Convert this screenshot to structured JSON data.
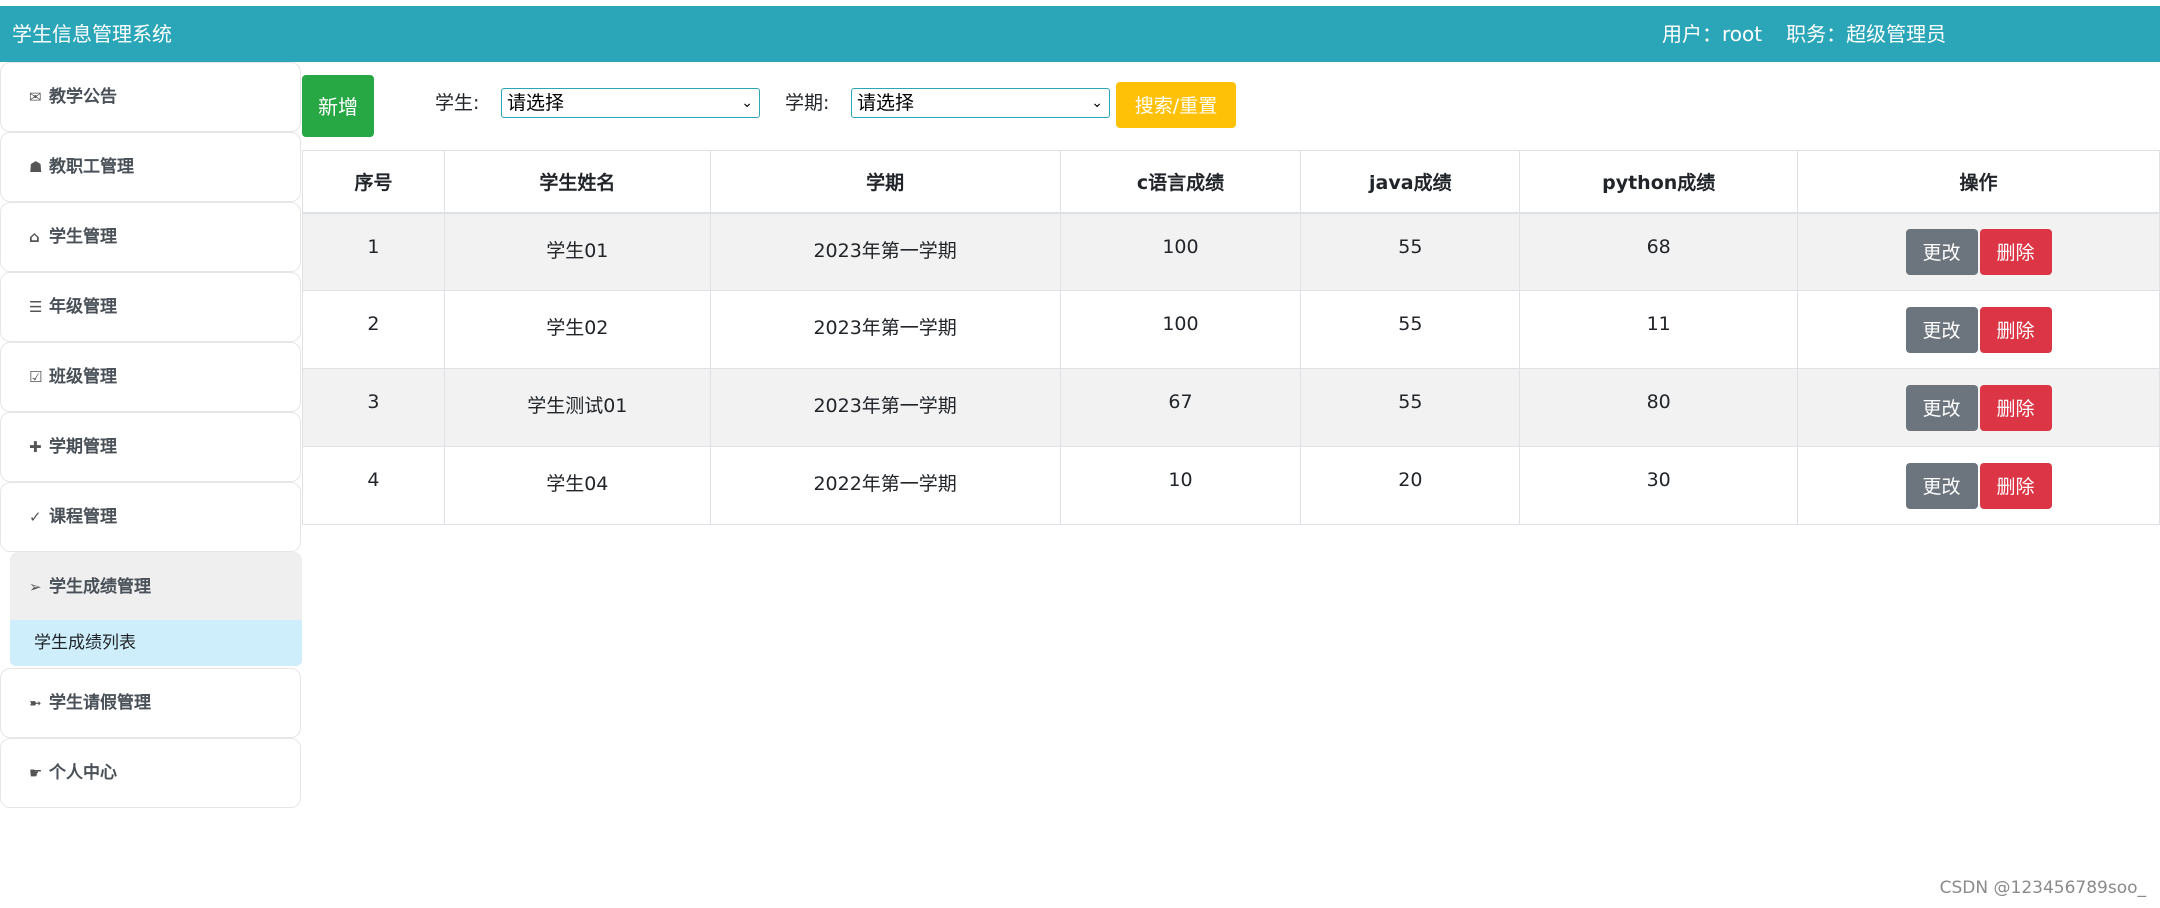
{
  "header": {
    "title": "学生信息管理系统",
    "user_label": "用户：",
    "user_name": "root",
    "role_label": "职务：",
    "role_name": "超级管理员"
  },
  "sidebar": {
    "items": [
      {
        "icon": "✉",
        "label": "教学公告"
      },
      {
        "icon": "☗",
        "label": "教职工管理"
      },
      {
        "icon": "⌂",
        "label": "学生管理"
      },
      {
        "icon": "☰",
        "label": "年级管理"
      },
      {
        "icon": "☑",
        "label": "班级管理"
      },
      {
        "icon": "✚",
        "label": "学期管理"
      },
      {
        "icon": "✓",
        "label": "课程管理"
      },
      {
        "icon": "➢",
        "label": "学生成绩管理"
      },
      {
        "icon": "➼",
        "label": "学生请假管理"
      },
      {
        "icon": "☛",
        "label": "个人中心"
      }
    ],
    "active_sub_item": "学生成绩列表"
  },
  "toolbar": {
    "add_label": "新增",
    "student_label": "学生:",
    "student_value": "请选择",
    "term_label": "学期:",
    "term_value": "请选择",
    "search_label": "搜索/重置"
  },
  "table": {
    "headers": [
      "序号",
      "学生姓名",
      "学期",
      "c语言成绩",
      "java成绩",
      "python成绩",
      "操作"
    ],
    "rows": [
      [
        "1",
        "学生01",
        "2023年第一学期",
        "100",
        "55",
        "68"
      ],
      [
        "2",
        "学生02",
        "2023年第一学期",
        "100",
        "55",
        "11"
      ],
      [
        "3",
        "学生测试01",
        "2023年第一学期",
        "67",
        "55",
        "80"
      ],
      [
        "4",
        "学生04",
        "2022年第一学期",
        "10",
        "20",
        "30"
      ]
    ],
    "edit_label": "更改",
    "delete_label": "删除"
  },
  "watermark": "CSDN @123456789soo_",
  "colors": {
    "header_bg": "#2ba6b9",
    "add_button": "#28a745",
    "search_button": "#ffc107",
    "edit_button": "#6c757d",
    "delete_button": "#dc3545",
    "active_sub_bg": "#cfeefb"
  }
}
